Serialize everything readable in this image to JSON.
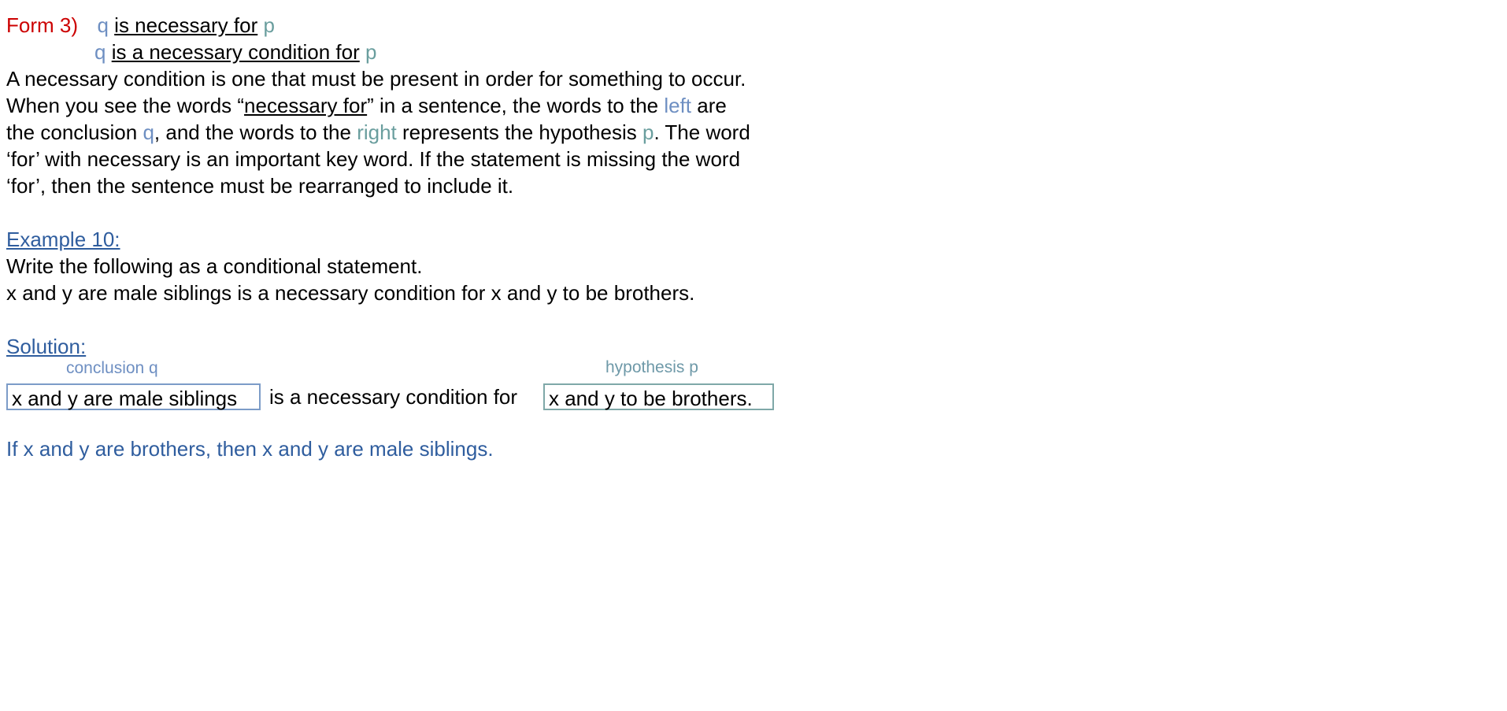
{
  "form": {
    "number_label": "Form 3)",
    "line1": {
      "q": "q",
      "phrase": "is necessary for",
      "p": "p"
    },
    "line2": {
      "q": "q",
      "phrase": "is a necessary condition for",
      "p": "p"
    }
  },
  "explanation": {
    "line1": "A necessary condition is one that must be present in order for something to occur.",
    "line2_a": "When you see the words “",
    "line2_key": "necessary for",
    "line2_b": "” in a sentence, the words to the ",
    "line2_left": "left",
    "line2_c": " are",
    "line3_a": "the conclusion ",
    "line3_q": "q",
    "line3_b": ", and the words to the ",
    "line3_right": "right",
    "line3_c": " represents the hypothesis ",
    "line3_p": "p",
    "line3_d": ".  The word",
    "line4": "‘for’ with necessary is an important key word.  If the statement is missing the word",
    "line5": "‘for’, then the sentence must be rearranged to include it."
  },
  "example": {
    "heading": "Example 10:",
    "instruction": "Write the following as a conditional statement.",
    "statement": "x and y are male siblings is a necessary condition for x and y to be brothers."
  },
  "solution": {
    "heading": "Solution:",
    "conclusion_label": "conclusion q",
    "hypothesis_label": "hypothesis p",
    "conclusion_box": "x and y are male siblings",
    "middle_text": "is a necessary condition for",
    "hypothesis_box": "x and y to be brothers.",
    "answer": "If x and y are brothers, then x and y are male siblings."
  },
  "colors": {
    "form_label": "#cc0000",
    "q_color": "#6e8fc2",
    "p_color": "#6a9e9e",
    "heading": "#2f5d9e",
    "answer": "#2f5d9e"
  }
}
